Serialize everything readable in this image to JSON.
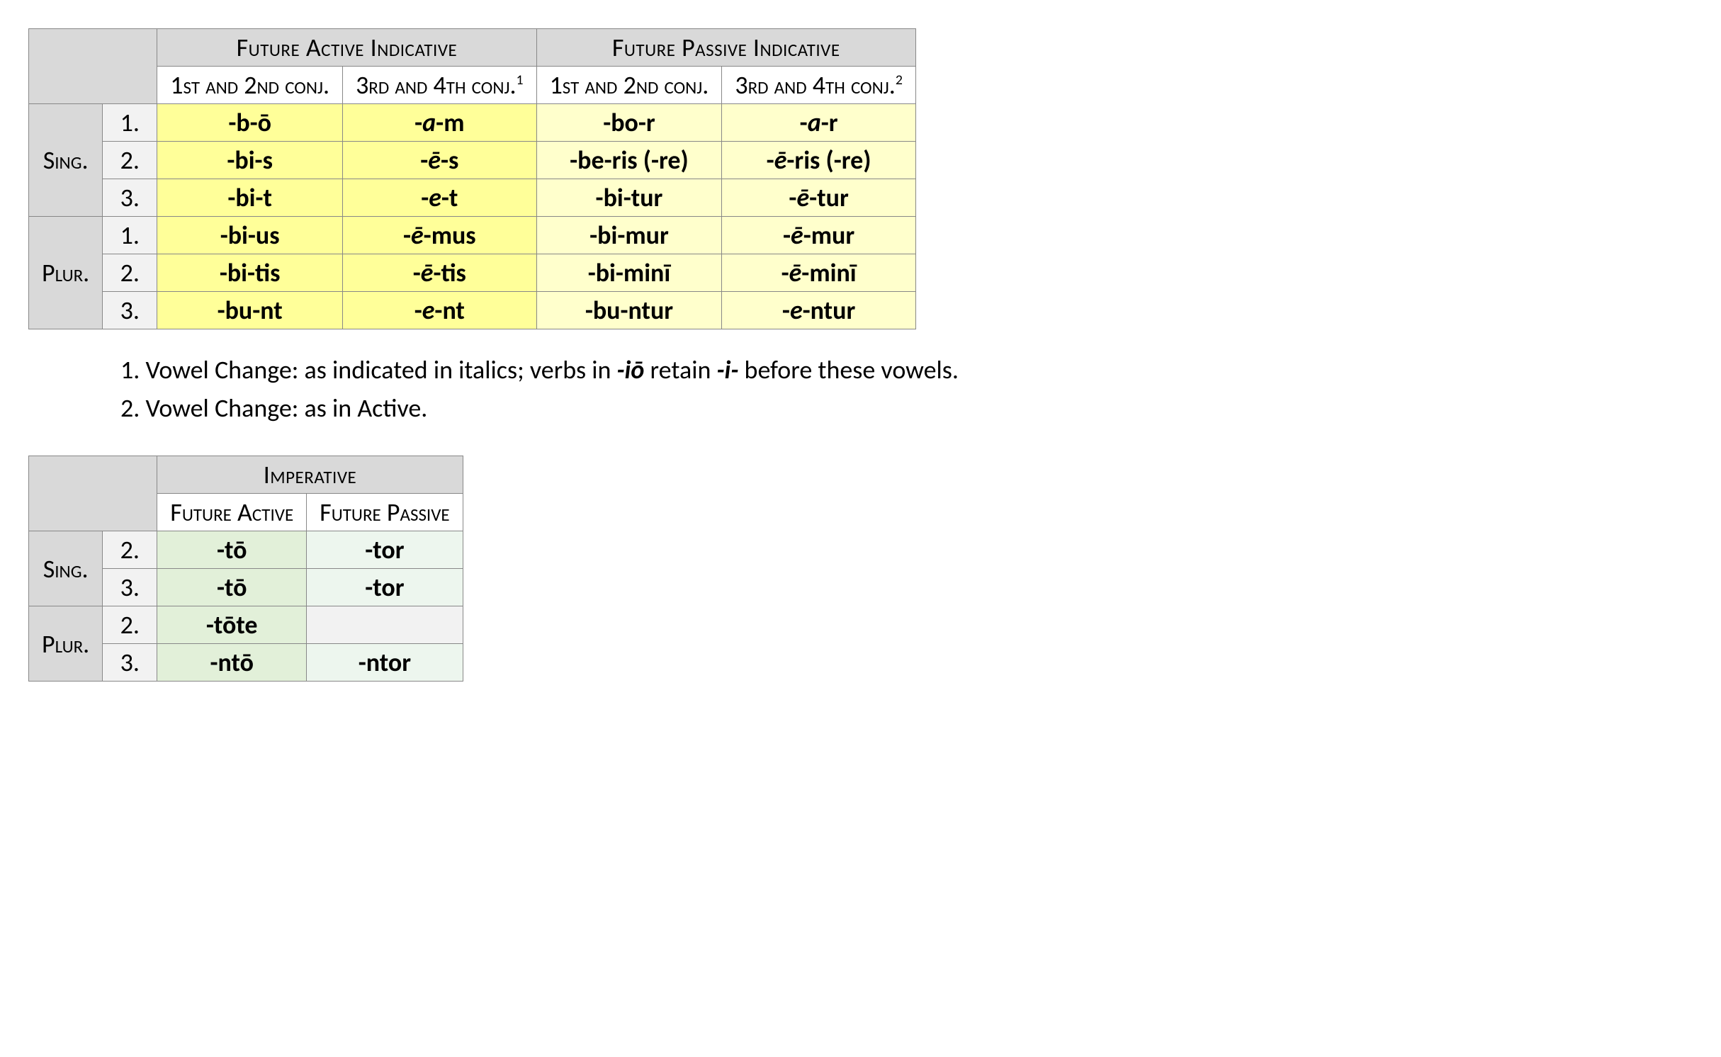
{
  "table1": {
    "main_headers": {
      "active": "Future Active Indicative",
      "passive": "Future Passive Indicative"
    },
    "sub_headers": {
      "conj12": "1st and 2nd conj.",
      "conj34": "3rd and 4th conj."
    },
    "superscripts": {
      "one": "1",
      "two": "2"
    },
    "row_groups": {
      "sing": "Sing.",
      "plur": "Plur."
    },
    "persons": {
      "p1": "1.",
      "p2": "2.",
      "p3": "3."
    },
    "rows": {
      "s1": {
        "a12": "-b-ō",
        "a34_pre": "-",
        "a34_v": "a",
        "a34_suf": "-m",
        "p12": "-bo-r",
        "p34_pre": "-",
        "p34_v": "a",
        "p34_suf": "-r"
      },
      "s2": {
        "a12": "-bi-s",
        "a34_pre": "-",
        "a34_v": "ē",
        "a34_suf": "-s",
        "p12": "-be-ris (-re)",
        "p34_pre": "-",
        "p34_v": "ē",
        "p34_suf": "-ris (-re)"
      },
      "s3": {
        "a12": "-bi-t",
        "a34_pre": "-",
        "a34_v": "e",
        "a34_suf": "-t",
        "p12": "-bi-tur",
        "p34_pre": "-",
        "p34_v": "ē",
        "p34_suf": "-tur"
      },
      "p1": {
        "a12": "-bi-us",
        "a34_pre": "-",
        "a34_v": "ē",
        "a34_suf": "-mus",
        "p12": "-bi-mur",
        "p34_pre": "-",
        "p34_v": "ē",
        "p34_suf": "-mur"
      },
      "p2": {
        "a12": "-bi-tis",
        "a34_pre": "-",
        "a34_v": "ē",
        "a34_suf": "-tis",
        "p12": "-bi-minī",
        "p34_pre": "-",
        "p34_v": "ē",
        "p34_suf": "-minī"
      },
      "p3": {
        "a12": "-bu-nt",
        "a34_pre": "-",
        "a34_v": "e",
        "a34_suf": "-nt",
        "p12": "-bu-ntur",
        "p34_pre": "-",
        "p34_v": "e",
        "p34_suf": "-ntur"
      }
    }
  },
  "notes": {
    "n1_prefix": "1. Vowel Change: as indicated in italics; verbs in ",
    "n1_io": "-iō",
    "n1_mid": " retain ",
    "n1_i": "-i-",
    "n1_suffix": " before these vowels.",
    "n2": "2. Vowel Change: as in Active."
  },
  "table2": {
    "main_header": "Imperative",
    "sub_headers": {
      "active": "Future Active",
      "passive": "Future Passive"
    },
    "row_groups": {
      "sing": "Sing.",
      "plur": "Plur."
    },
    "persons": {
      "p2": "2.",
      "p3": "3."
    },
    "rows": {
      "s2": {
        "a": "-tō",
        "p": "-tor"
      },
      "s3": {
        "a": "-tō",
        "p": "-tor"
      },
      "p2": {
        "a": "-tōte",
        "p": ""
      },
      "p3": {
        "a": "-ntō",
        "p": "-ntor"
      }
    }
  }
}
